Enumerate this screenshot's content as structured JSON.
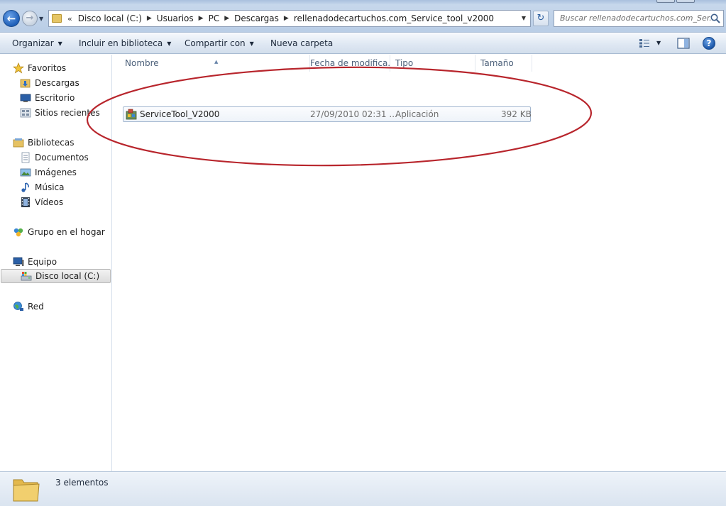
{
  "toolbar": {
    "back_icon": "back-arrow-icon",
    "forward_icon": "forward-arrow-icon",
    "breadcrumbs": [
      "Disco local (C:)",
      "Usuarios",
      "PC",
      "Descargas",
      "rellenadodecartuchos.com_Service_tool_v2000"
    ],
    "search_placeholder": "Buscar rellenadodecartuchos.com_Ser..."
  },
  "commands": {
    "organize": "Organizar",
    "include_in_library": "Incluir en biblioteca",
    "share_with": "Compartir con",
    "new_folder": "Nueva carpeta"
  },
  "sidebar": {
    "favorites": {
      "label": "Favoritos",
      "items": [
        {
          "label": "Descargas",
          "icon": "downloads-folder-icon"
        },
        {
          "label": "Escritorio",
          "icon": "desktop-icon"
        },
        {
          "label": "Sitios recientes",
          "icon": "recent-places-icon"
        }
      ]
    },
    "libraries": {
      "label": "Bibliotecas",
      "items": [
        {
          "label": "Documentos",
          "icon": "documents-icon"
        },
        {
          "label": "Imágenes",
          "icon": "pictures-icon"
        },
        {
          "label": "Música",
          "icon": "music-icon"
        },
        {
          "label": "Vídeos",
          "icon": "videos-icon"
        }
      ]
    },
    "homegroup": {
      "label": "Grupo en el hogar"
    },
    "computer": {
      "label": "Equipo",
      "items": [
        {
          "label": "Disco local (C:)",
          "icon": "local-disk-icon",
          "selected": true
        }
      ]
    },
    "network": {
      "label": "Red"
    }
  },
  "file_list": {
    "columns": [
      "Nombre",
      "Fecha de modifica...",
      "Tipo",
      "Tamaño"
    ],
    "rows": [
      {
        "name": "ServiceTool_V2000",
        "date": "27/09/2010 02:31 ...",
        "type": "Aplicación",
        "size": "392 KB"
      }
    ]
  },
  "status": {
    "item_count": "3 elementos"
  },
  "colors": {
    "annotation_ellipse": "#b8252c",
    "accent": "#1f5fb8"
  }
}
